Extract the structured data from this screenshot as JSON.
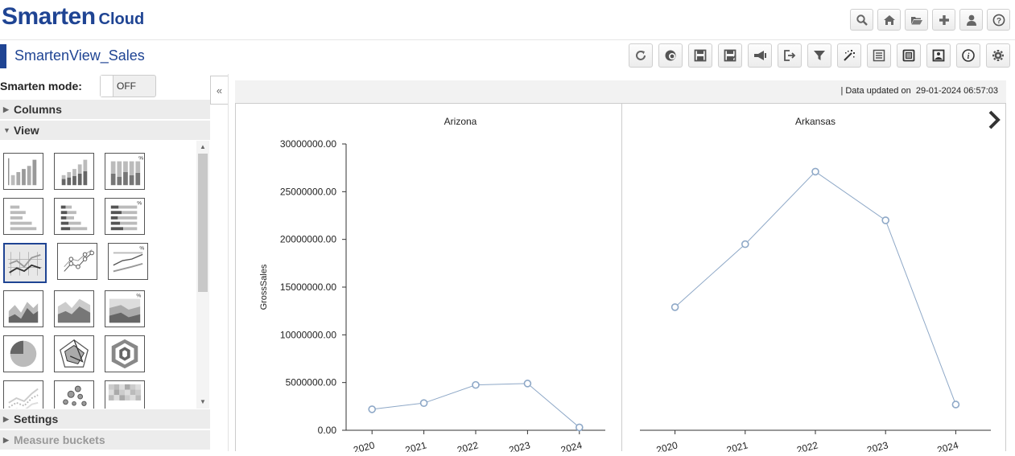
{
  "header": {
    "brand_big": "Smarten",
    "brand_small": "Cloud",
    "icons": [
      "search-icon",
      "home-icon",
      "folder-icon",
      "plus-icon",
      "user-icon",
      "help-icon"
    ]
  },
  "titlebar": {
    "title": "SmartenView_Sales",
    "tools": [
      "refresh-icon",
      "globe-icon",
      "save-icon",
      "save-as-icon",
      "announce-icon",
      "export-icon",
      "filter-icon",
      "magic-wand-icon",
      "list-icon",
      "news-icon",
      "image-icon",
      "info-icon",
      "settings-icon"
    ]
  },
  "sidebar": {
    "smarten_mode_label": "Smarten mode:",
    "toggle_label": "OFF",
    "sections": {
      "columns": "Columns",
      "view": "View",
      "settings": "Settings",
      "measure_buckets": "Measure buckets"
    },
    "selected_view": "line-chart-grid"
  },
  "main": {
    "updated_prefix": "|  Data updated on",
    "updated_value": "29-01-2024 06:57:03"
  },
  "chart_data": [
    {
      "type": "line",
      "title": "Arizona",
      "ylabel": "GrossSales",
      "x": [
        "2020",
        "2021",
        "2022",
        "2023",
        "2024"
      ],
      "y": [
        2200000,
        2850000,
        4750000,
        4900000,
        300000
      ],
      "ylim": [
        0,
        30000000
      ],
      "yticks": [
        "30000000.00",
        "25000000.00",
        "20000000.00",
        "15000000.00",
        "10000000.00",
        "5000000.00",
        "0.00"
      ],
      "color": "#8ea8c7"
    },
    {
      "type": "line",
      "title": "Arkansas",
      "x": [
        "2020",
        "2021",
        "2022",
        "2023",
        "2024"
      ],
      "y": [
        12900000,
        19500000,
        27100000,
        22000000,
        2700000
      ],
      "ylim": [
        0,
        30000000
      ],
      "color": "#8ea8c7"
    }
  ]
}
